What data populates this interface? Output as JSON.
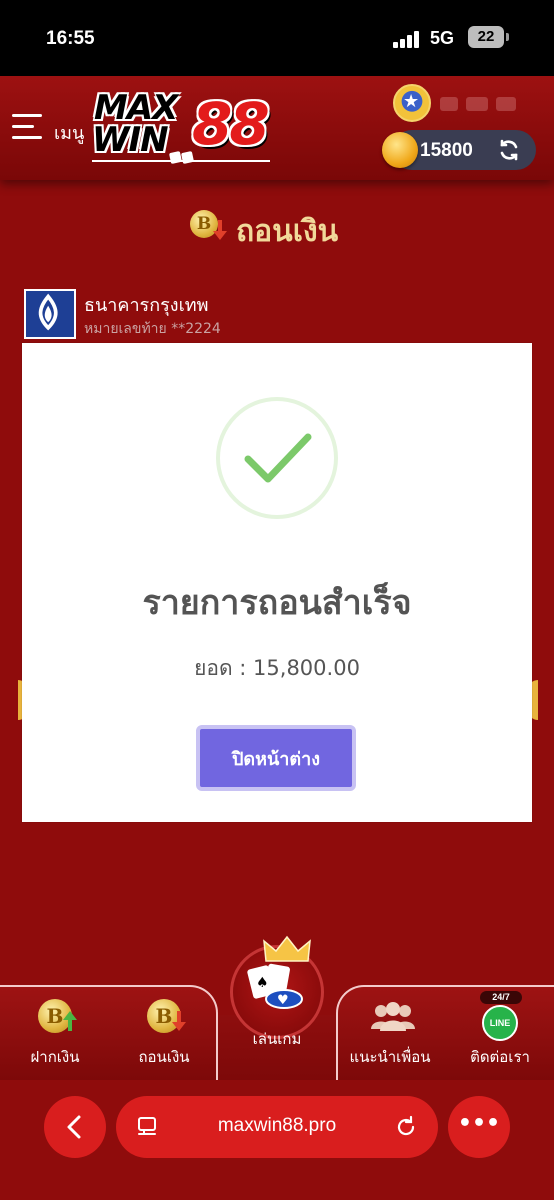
{
  "status_bar": {
    "time": "16:55",
    "network": "5G",
    "battery": "22"
  },
  "header": {
    "menu_label": "เมนู",
    "logo_text_top": "MAX",
    "logo_text_bottom": "WIN",
    "logo_text_number": "88",
    "balance": "15800"
  },
  "page": {
    "title": "ถอนเงิน",
    "coin_glyph": "B",
    "bank": {
      "name": "ธนาคารกรุงเทพ",
      "account": "หมายเลขท้าย **2224"
    }
  },
  "modal": {
    "title": "รายการถอนสำเร็จ",
    "amount_label": "ยอด : ",
    "amount_value": "15,800.00",
    "close_button": "ปิดหน้าต่าง"
  },
  "bottom_nav": {
    "deposit": "ฝากเงิน",
    "withdraw": "ถอนเงิน",
    "play": "เล่นเกม",
    "refer": "แนะนำเพื่อน",
    "contact": "ติดต่อเรา",
    "line_badge": "24/7",
    "line_text": "LINE"
  },
  "browser": {
    "url": "maxwin88.pro",
    "more": "•••"
  },
  "colors": {
    "background": "#8f0c0c",
    "modal_button": "#7166e0",
    "success_check": "#7cc96a",
    "title_gold": "#f1d99a",
    "browser_button": "#d91e1e"
  }
}
